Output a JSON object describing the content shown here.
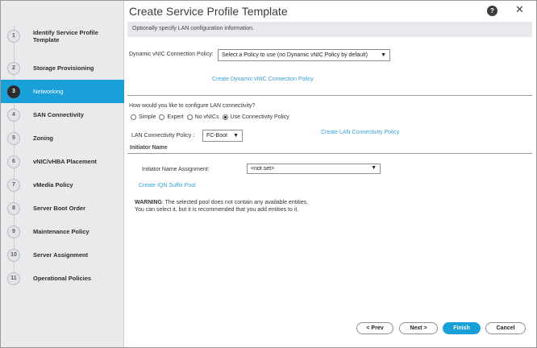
{
  "window": {
    "title": "Create Service Profile Template",
    "help_label": "?",
    "close_label": "✕"
  },
  "steps": [
    {
      "num": "1",
      "label": "Identify Service Profile Template",
      "active": false
    },
    {
      "num": "2",
      "label": "Storage Provisioning",
      "active": false
    },
    {
      "num": "3",
      "label": "Networking",
      "active": true
    },
    {
      "num": "4",
      "label": "SAN Connectivity",
      "active": false
    },
    {
      "num": "5",
      "label": "Zoning",
      "active": false
    },
    {
      "num": "6",
      "label": "vNIC/vHBA Placement",
      "active": false
    },
    {
      "num": "7",
      "label": "vMedia Policy",
      "active": false
    },
    {
      "num": "8",
      "label": "Server Boot Order",
      "active": false
    },
    {
      "num": "9",
      "label": "Maintenance Policy",
      "active": false
    },
    {
      "num": "10",
      "label": "Server Assignment",
      "active": false
    },
    {
      "num": "11",
      "label": "Operational Policies",
      "active": false
    }
  ],
  "info": "Optionally specify LAN configuration information.",
  "dynamic_vnic": {
    "label": "Dynamic vNIC Connection Policy:",
    "value": "Select a Policy to use (no Dynamic vNIC Policy by default)",
    "create_link": "Create Dynamic vNIC Connection Policy"
  },
  "lan": {
    "question": "How would you like to configure LAN connectivity?",
    "options": [
      "Simple",
      "Expert",
      "No vNICs",
      "Use Connectivity Policy"
    ],
    "selected": "Use Connectivity Policy",
    "policy_label": "LAN Connectivity Policy :",
    "policy_value": "FC-Boot",
    "create_link": "Create LAN Connectivity Policy"
  },
  "initiator": {
    "section_title": "Initiator Name",
    "assignment_label": "Initiator Name Assignment:",
    "assignment_value": "<not set>",
    "create_link": "Create IQN Suffix Pool",
    "warning_title": "WARNING",
    "warning_text": ": The selected pool does not contain any available entities.",
    "warning_text2": "You can select it, but it is recommended that you add entities to it."
  },
  "buttons": {
    "prev": "< Prev",
    "next": "Next >",
    "finish": "Finish",
    "cancel": "Cancel"
  },
  "colors": {
    "accent": "#1aa0d8",
    "link": "#3aa0d4",
    "sidebar_bg": "#e9eaec"
  }
}
